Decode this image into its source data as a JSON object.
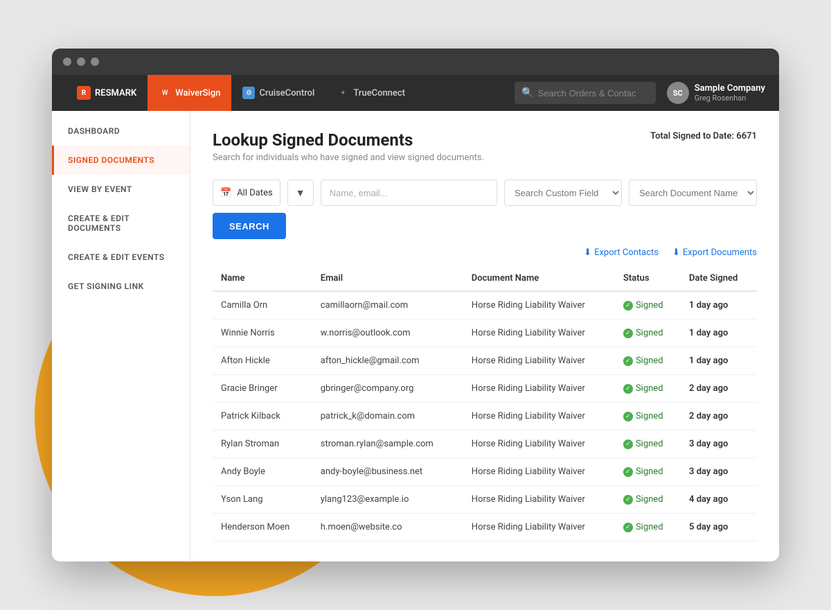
{
  "browser": {
    "dots": [
      "dot1",
      "dot2",
      "dot3"
    ]
  },
  "nav": {
    "logo_label": "RESMARK",
    "apps": [
      {
        "id": "waiversign",
        "label": "WaiverSign",
        "icon": "W",
        "active": true
      },
      {
        "id": "cruisecontrol",
        "label": "CruiseControl",
        "icon": "C",
        "active": false
      },
      {
        "id": "trueconnect",
        "label": "TrueConnect",
        "icon": "✦",
        "active": false
      }
    ],
    "search_placeholder": "Search Orders & Contac",
    "company_name": "Sample Company",
    "company_user": "Greg Rosenhan",
    "company_initials": "SC"
  },
  "sidebar": {
    "items": [
      {
        "id": "dashboard",
        "label": "DASHBOARD",
        "active": false
      },
      {
        "id": "signed-documents",
        "label": "SIGNED DOCUMENTS",
        "active": true
      },
      {
        "id": "view-by-event",
        "label": "VIEW BY EVENT",
        "active": false
      },
      {
        "id": "create-edit-documents",
        "label": "CREATE & EDIT DOCUMENTS",
        "active": false
      },
      {
        "id": "create-edit-events",
        "label": "CREATE & EDIT EVENTS",
        "active": false
      },
      {
        "id": "get-signing-link",
        "label": "GET SIGNING LINK",
        "active": false
      }
    ]
  },
  "page": {
    "title": "Lookup Signed Documents",
    "subtitle": "Search for individuals who have signed and view signed documents.",
    "total_label": "Total Signed to Date:",
    "total_count": "6671"
  },
  "search": {
    "date_label": "All Dates",
    "name_placeholder": "Name, email...",
    "custom_field_label": "Search Custom Field",
    "doc_name_label": "Search Document Name",
    "button_label": "SEARCH",
    "custom_field_options": [
      "Search Custom Field"
    ],
    "doc_name_options": [
      "Search Document Name"
    ]
  },
  "exports": {
    "contacts_label": "Export Contacts",
    "documents_label": "Export Documents"
  },
  "table": {
    "columns": [
      "Name",
      "Email",
      "Document Name",
      "Status",
      "Date Signed"
    ],
    "rows": [
      {
        "name": "Camilla Orn",
        "email": "camillaorn@mail.com",
        "document": "Horse Riding Liability Waiver",
        "status": "Signed",
        "date": "1 day ago"
      },
      {
        "name": "Winnie Norris",
        "email": "w.norris@outlook.com",
        "document": "Horse Riding Liability Waiver",
        "status": "Signed",
        "date": "1 day ago"
      },
      {
        "name": "Afton Hickle",
        "email": "afton_hickle@gmail.com",
        "document": "Horse Riding Liability Waiver",
        "status": "Signed",
        "date": "1 day ago"
      },
      {
        "name": "Gracie Bringer",
        "email": "gbringer@company.org",
        "document": "Horse Riding Liability Waiver",
        "status": "Signed",
        "date": "2 day ago"
      },
      {
        "name": "Patrick Kilback",
        "email": "patrick_k@domain.com",
        "document": "Horse Riding Liability Waiver",
        "status": "Signed",
        "date": "2 day ago"
      },
      {
        "name": "Rylan Stroman",
        "email": "stroman.rylan@sample.com",
        "document": "Horse Riding Liability Waiver",
        "status": "Signed",
        "date": "3 day ago"
      },
      {
        "name": "Andy Boyle",
        "email": "andy-boyle@business.net",
        "document": "Horse Riding Liability Waiver",
        "status": "Signed",
        "date": "3 day ago"
      },
      {
        "name": "Yson Lang",
        "email": "ylang123@example.io",
        "document": "Horse Riding Liability Waiver",
        "status": "Signed",
        "date": "4 day ago"
      },
      {
        "name": "Henderson Moen",
        "email": "h.moen@website.co",
        "document": "Horse Riding Liability Waiver",
        "status": "Signed",
        "date": "5 day ago"
      }
    ]
  }
}
